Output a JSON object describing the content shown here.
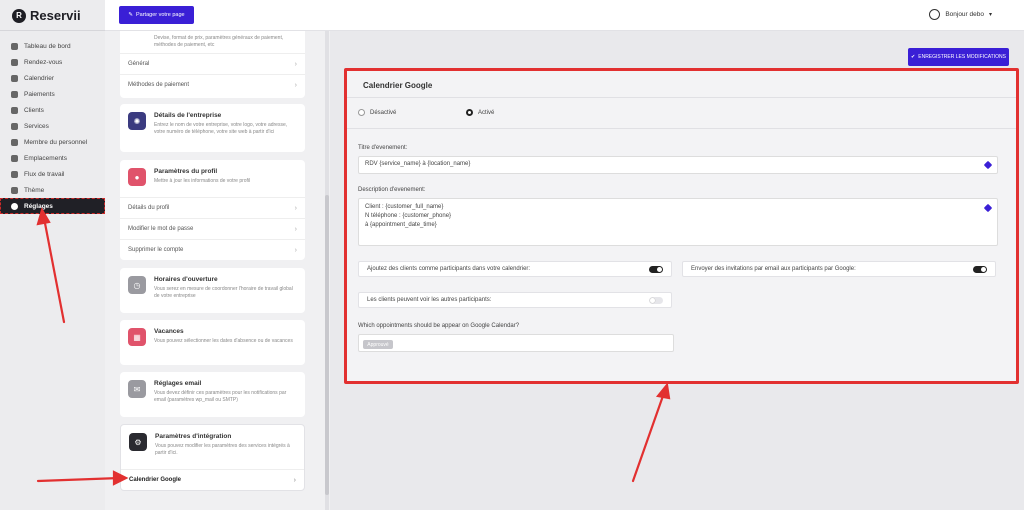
{
  "app": {
    "logo_letter": "R",
    "name": "Reservii"
  },
  "sidebar": {
    "items": [
      {
        "label": "Tableau de bord",
        "icon": "dashboard-icon"
      },
      {
        "label": "Rendez-vous",
        "icon": "calendar-check-icon"
      },
      {
        "label": "Calendrier",
        "icon": "calendar-icon"
      },
      {
        "label": "Paiements",
        "icon": "payment-icon"
      },
      {
        "label": "Clients",
        "icon": "users-icon"
      },
      {
        "label": "Services",
        "icon": "services-icon"
      },
      {
        "label": "Membre du personnel",
        "icon": "staff-icon"
      },
      {
        "label": "Emplacements",
        "icon": "location-icon"
      },
      {
        "label": "Flux de travail",
        "icon": "workflow-icon"
      },
      {
        "label": "Thème",
        "icon": "brush-icon"
      },
      {
        "label": "Réglages",
        "icon": "gear-icon",
        "active": true
      }
    ]
  },
  "topbar": {
    "share_label": "Partager votre page",
    "greeting": "Bonjour debo"
  },
  "settings": {
    "top_card_desc": "Devise, format de prix, paramètres généraux de paiement, méthodes de paiement, etc",
    "rows_top": [
      "Général",
      "Méthodes de paiement"
    ],
    "business": {
      "title": "Détails de l'entreprise",
      "desc": "Entrez le nom de votre entreprise, votre logo, votre adresse, votre numéro de téléphone, votre site web à partir d'ici"
    },
    "profile": {
      "title": "Paramètres du profil",
      "desc": "Mettre à jour les informations de votre profil"
    },
    "profile_rows": [
      "Détails du profil",
      "Modifier le mot de passe",
      "Supprimer le compte"
    ],
    "hours": {
      "title": "Horaires d'ouverture",
      "desc": "Vous serez en mesure de coordonner l'horaire de travail global de votre entreprise"
    },
    "vacation": {
      "title": "Vacances",
      "desc": "Vous pouvez sélectionner les dates d'absence ou de vacances"
    },
    "email": {
      "title": "Réglages email",
      "desc": "Vous devez définir ces paramètres pour les notifications par email (paramètres wp_mail ou SMTP)"
    },
    "integration": {
      "title": "Paramètres d'intégration",
      "desc": "Vous pouvez modifier les paramètres des services intégrés à partir d'ici."
    },
    "gcal_row": "Calendrier Google"
  },
  "main": {
    "save_label": "ENREGISTRER LES MODIFICATIONS",
    "title": "Calendrier Google",
    "radio_off": "Désactivé",
    "radio_on": "Activé",
    "event_title_label": "Titre d'evenement:",
    "event_title_value": "RDV {service_name} à {location_name}",
    "event_desc_label": "Description d'evenement:",
    "event_desc_lines": [
      "Client : {customer_full_name}",
      "N téléphone : {customer_phone}",
      "à {appointment_date_time}"
    ],
    "toggle_add_clients": "Ajoutez des clients comme participants dans votre calendrier:",
    "toggle_send_invites": "Envoyer des invitations par email aux participants par Google:",
    "toggle_see_others": "Les clients peuvent voir les autres participants:",
    "which_label": "Which oppointments should be appear on Google Calendar?",
    "approved_pill": "Approuvé"
  },
  "colors": {
    "accent": "#3a1fd6",
    "annotation": "#e23030",
    "dark": "#202026"
  }
}
